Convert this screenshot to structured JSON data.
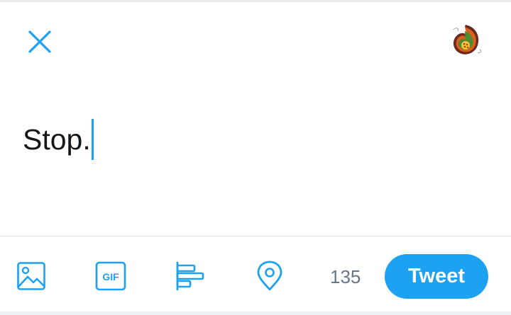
{
  "composer": {
    "text": "Stop.",
    "char_counter": "135",
    "tweet_label": "Tweet"
  },
  "icons": {
    "close": "close-icon",
    "avatar": "user-avatar",
    "media": "image-icon",
    "gif": "gif-icon",
    "poll": "poll-icon",
    "location": "location-pin-icon"
  },
  "gif_label": "GIF",
  "colors": {
    "accent": "#1da1f2",
    "text": "#14171a",
    "muted": "#657786"
  }
}
